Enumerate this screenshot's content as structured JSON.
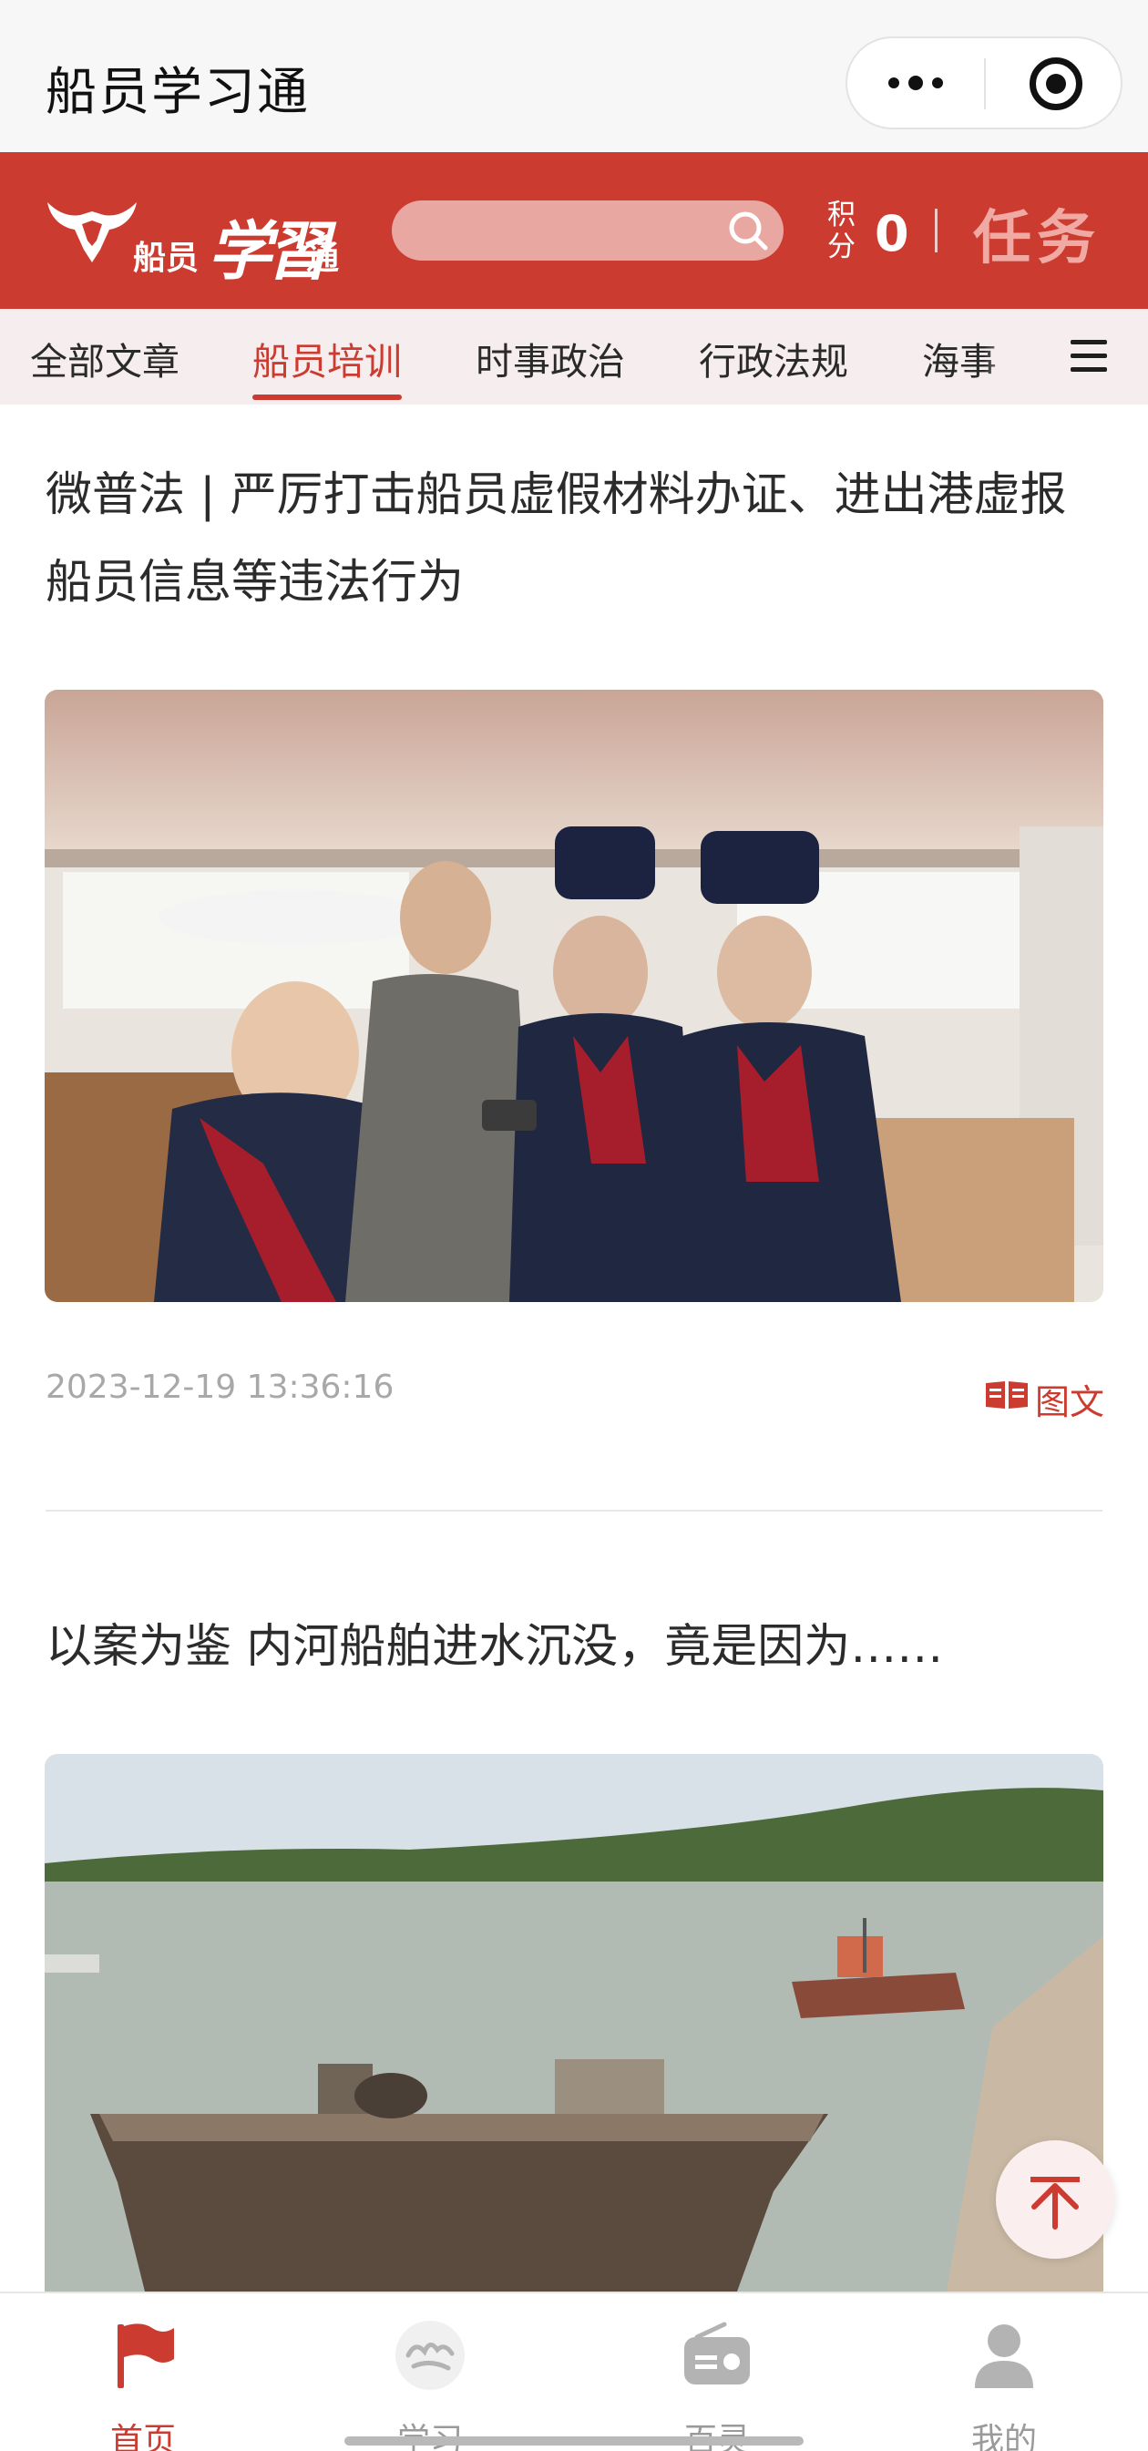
{
  "app": {
    "title": "船员学习通"
  },
  "header": {
    "logo_text_1": "船员",
    "logo_text_2": "学習",
    "logo_text_3": "通",
    "search_placeholder": "",
    "points_label": "积分",
    "points_value": "0",
    "task_label": "任务"
  },
  "tabs": [
    {
      "label": "全部文章",
      "active": false
    },
    {
      "label": "船员培训",
      "active": true
    },
    {
      "label": "时事政治",
      "active": false
    },
    {
      "label": "行政法规",
      "active": false
    },
    {
      "label": "海事",
      "active": false
    }
  ],
  "articles": [
    {
      "title": "微普法 | 严厉打击船员虚假材料办证、进出港虚报船员信息等违法行为",
      "date": "2023-12-19 13:36:16",
      "type_label": "图文"
    },
    {
      "title": "以案为鉴 内河船舶进水沉没，竟是因为……"
    }
  ],
  "bottom_nav": [
    {
      "label": "首页",
      "icon": "flag-icon",
      "active": true
    },
    {
      "label": "学习",
      "icon": "study-logo-icon",
      "active": false
    },
    {
      "label": "百灵",
      "icon": "radio-icon",
      "active": false
    },
    {
      "label": "我的",
      "icon": "user-icon",
      "active": false
    }
  ],
  "colors": {
    "brand_red": "#cc3b30",
    "tab_bg": "#f6eeee",
    "muted": "#a8a8a8"
  }
}
